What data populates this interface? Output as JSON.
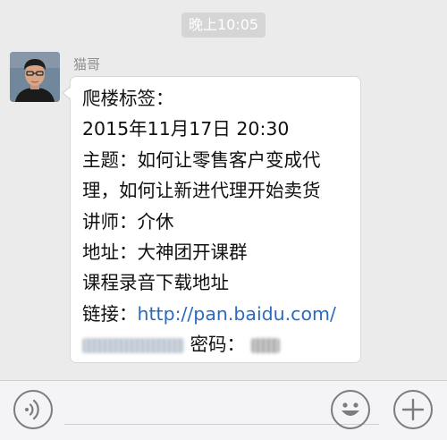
{
  "chat": {
    "timestamp": "晚上10:05",
    "sender_name": "猫哥",
    "message": {
      "title": "爬楼标签：",
      "datetime": "2015年11月17日 20:30",
      "topic_line1": "主题：如何让零售客户变成代",
      "topic_line2": "理，如何让新进代理开始卖货",
      "lecturer": "讲师：介休",
      "address": "地址：大神团开课群",
      "recording": "课程录音下载地址",
      "link_label": "链接：",
      "link_url": "http://pan.baidu.com/",
      "password_label": "密码："
    }
  },
  "icons": {
    "voice": "voice-icon",
    "emoji": "emoji-icon",
    "plus": "plus-icon"
  },
  "colors": {
    "background": "#ebebeb",
    "bubble": "#ffffff",
    "link": "#2a6bbf",
    "time_badge": "#d5d5d5"
  }
}
